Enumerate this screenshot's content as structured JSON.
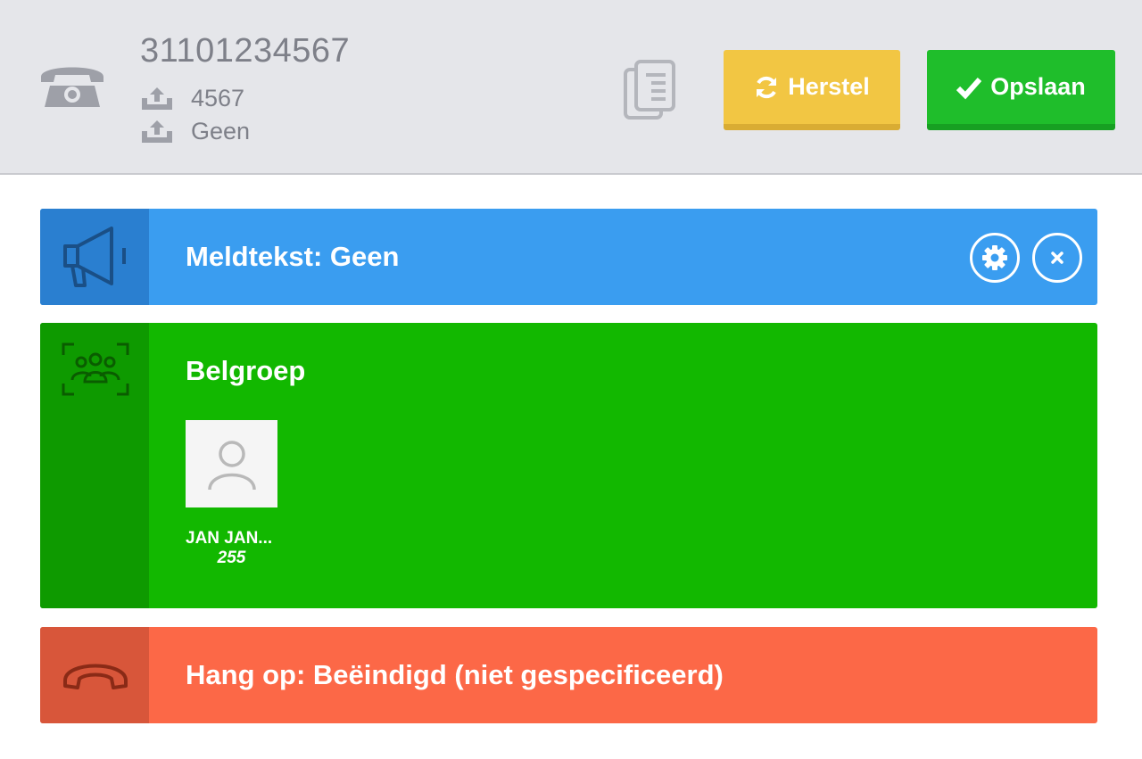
{
  "header": {
    "number": "31101234567",
    "extension": "4567",
    "forward": "Geen",
    "icons": {
      "phone": "telephone-icon",
      "extension": "upload-tray-icon",
      "forward": "upload-tray-icon",
      "copy": "copy-icon"
    }
  },
  "buttons": {
    "herstel": {
      "label": "Herstel",
      "icon": "refresh-icon",
      "color": "#f2c643"
    },
    "opslaan": {
      "label": "Opslaan",
      "icon": "checkmark-icon",
      "color": "#1fbe2b"
    }
  },
  "panels": {
    "meldtekst": {
      "title": "Meldtekst: Geen",
      "color": "#3a9df0",
      "icon": "megaphone-icon",
      "actions": [
        "gear-icon",
        "close-icon"
      ]
    },
    "belgroep": {
      "title": "Belgroep",
      "color": "#12b800",
      "icon": "group-icon",
      "members": [
        {
          "name": "JAN JAN...",
          "extension": "255",
          "icon": "user-avatar-icon"
        }
      ]
    },
    "hangop": {
      "title": "Hang op: Beëindigd (niet gespecificeerd)",
      "color": "#fc6847",
      "icon": "hangup-icon"
    }
  }
}
